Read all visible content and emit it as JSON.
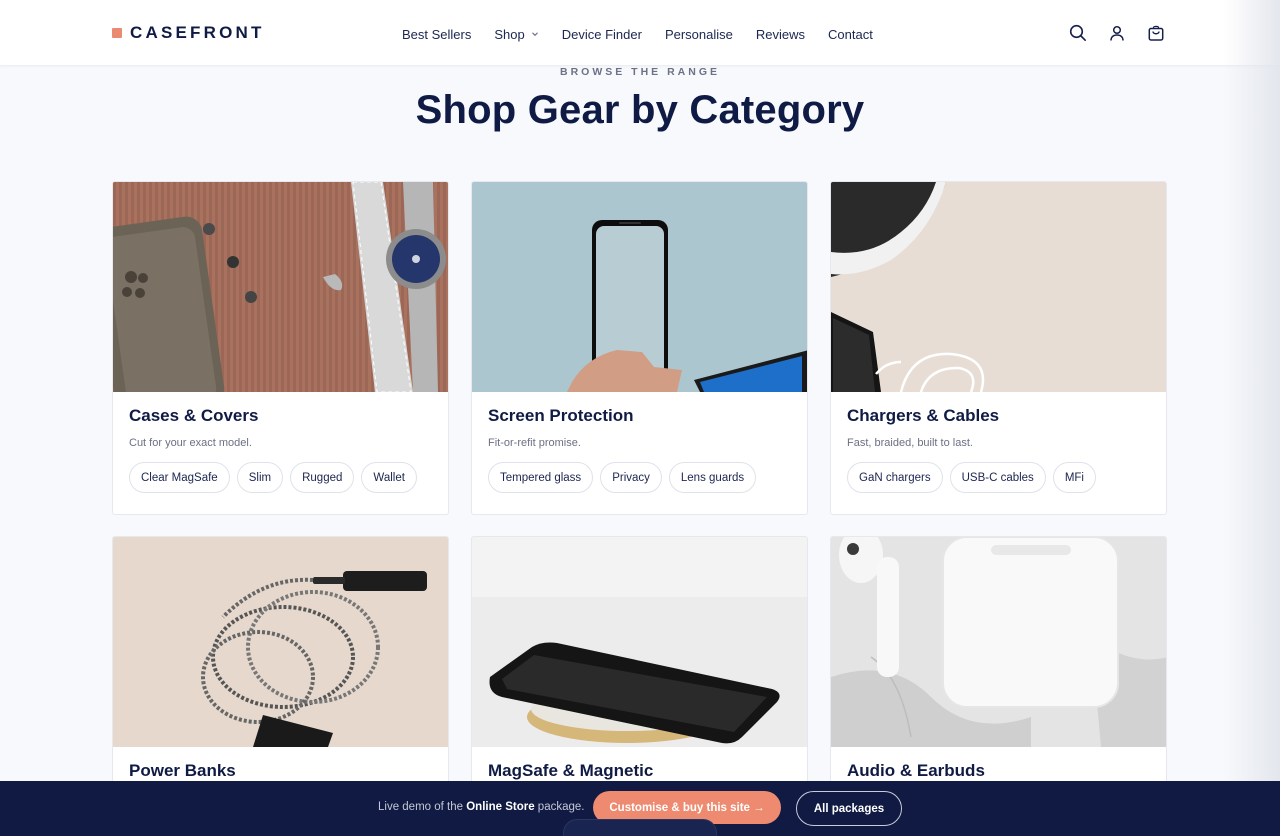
{
  "brand": {
    "name": "CASEFRONT",
    "accent": "#ea8a72"
  },
  "nav": {
    "items": [
      {
        "label": "Best Sellers"
      },
      {
        "label": "Shop"
      },
      {
        "label": "Device Finder"
      },
      {
        "label": "Personalise"
      },
      {
        "label": "Reviews"
      },
      {
        "label": "Contact"
      }
    ]
  },
  "header_icons": [
    "search-icon",
    "account-icon",
    "cart-icon"
  ],
  "section": {
    "eyebrow": "BROWSE THE RANGE",
    "title": "Shop Gear by Category"
  },
  "categories": [
    {
      "title": "Cases & Covers",
      "subtitle": "Cut for your exact model.",
      "tags": [
        "Clear MagSafe",
        "Slim",
        "Rugged",
        "Wallet"
      ]
    },
    {
      "title": "Screen Protection",
      "subtitle": "Fit-or-refit promise.",
      "tags": [
        "Tempered glass",
        "Privacy",
        "Lens guards"
      ]
    },
    {
      "title": "Chargers & Cables",
      "subtitle": "Fast, braided, built to last.",
      "tags": [
        "GaN chargers",
        "USB-C cables",
        "MFi"
      ]
    },
    {
      "title": "Power Banks"
    },
    {
      "title": "MagSafe & Magnetic"
    },
    {
      "title": "Audio & Earbuds"
    }
  ],
  "demo_bar": {
    "text_before": "Live demo of the ",
    "text_bold": "Online Store",
    "text_after": " package.",
    "primary_label": "Customise & buy this site →",
    "secondary_label": "All packages",
    "primary_color": "#ee8a70",
    "background": "#101a42"
  }
}
